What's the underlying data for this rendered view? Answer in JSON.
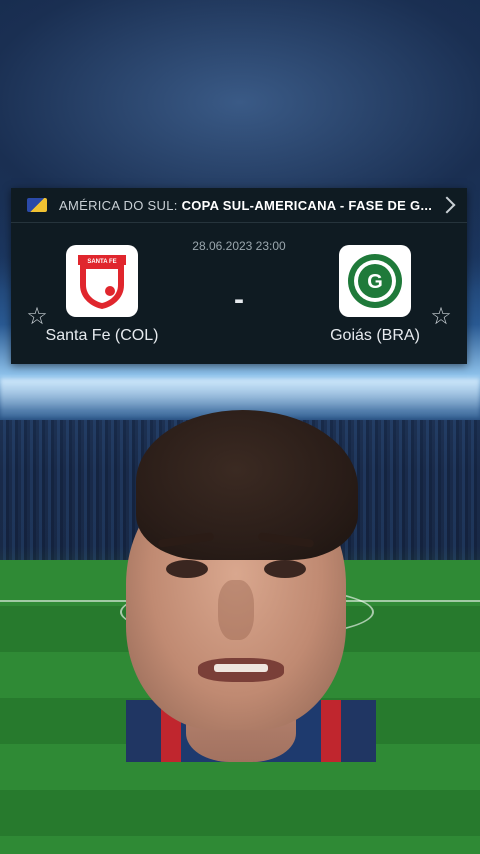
{
  "header": {
    "region": "AMÉRICA DO SUL:",
    "competition": "COPA SUL-AMERICANA - FASE DE G..."
  },
  "match": {
    "datetime": "28.06.2023 23:00",
    "score": "-",
    "home": {
      "name": "Santa Fe (COL)",
      "badge_text": "SANTA FE"
    },
    "away": {
      "name": "Goiás (BRA)",
      "badge_text": "GOIÁS ESPORTE CLUBE"
    }
  },
  "icons": {
    "star": "☆",
    "flag": "south-america-flag-icon",
    "chevron": "chevron-right-icon"
  },
  "colors": {
    "card_bg": "#0f1b22",
    "santa_fe_red": "#e0262d",
    "goias_green": "#1f7a3a"
  }
}
